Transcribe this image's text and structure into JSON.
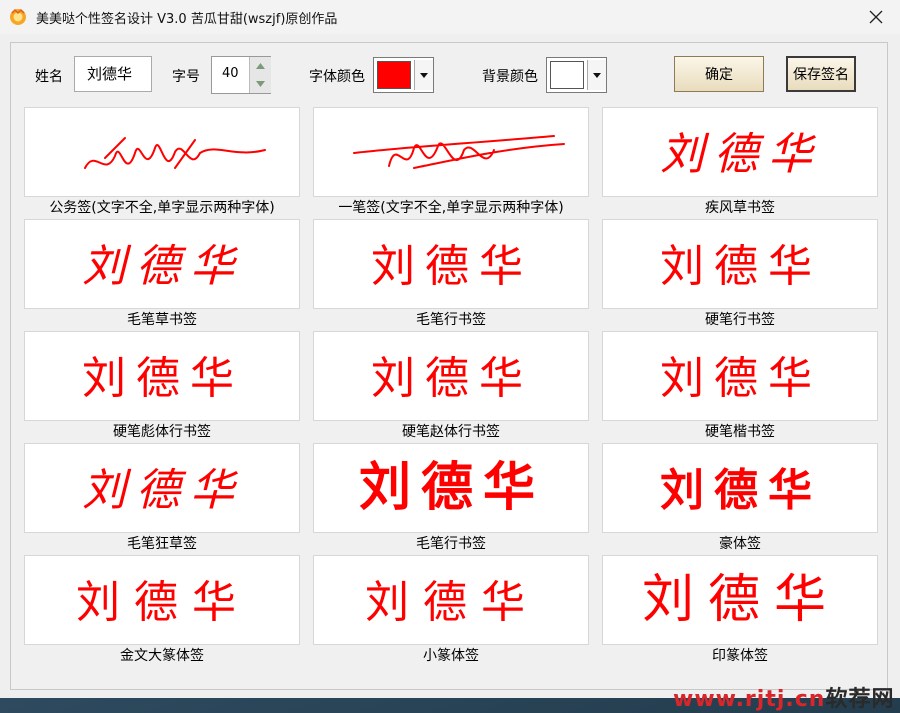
{
  "window": {
    "title": "美美哒个性签名设计 V3.0   苦瓜甘甜(wszjf)原创作品"
  },
  "toolbar": {
    "name_label": "姓名",
    "name_value": "刘德华",
    "size_label": "字号",
    "size_value": "40",
    "font_color_label": "字体颜色",
    "font_color": "#ff0000",
    "bg_color_label": "背景颜色",
    "bg_color": "#ffffff",
    "confirm_label": "确定",
    "save_label": "保存签名"
  },
  "signature_text": "刘德华",
  "signature_color": "#ff0000",
  "styles": [
    {
      "name": "公务签(文字不全,单字显示两种字体)"
    },
    {
      "name": "一笔签(文字不全,单字显示两种字体)"
    },
    {
      "name": "疾风草书签"
    },
    {
      "name": "毛笔草书签"
    },
    {
      "name": "毛笔行书签"
    },
    {
      "name": "硬笔行书签"
    },
    {
      "name": "硬笔彪体行书签"
    },
    {
      "name": "硬笔赵体行书签"
    },
    {
      "name": "硬笔楷书签"
    },
    {
      "name": "毛笔狂草签"
    },
    {
      "name": "毛笔行书签"
    },
    {
      "name": "豪体签"
    },
    {
      "name": "金文大篆体签"
    },
    {
      "name": "小篆体签"
    },
    {
      "name": "印篆体签"
    }
  ],
  "watermark": {
    "site": "www.rjtj.cn",
    "suffix": "软荐网"
  }
}
